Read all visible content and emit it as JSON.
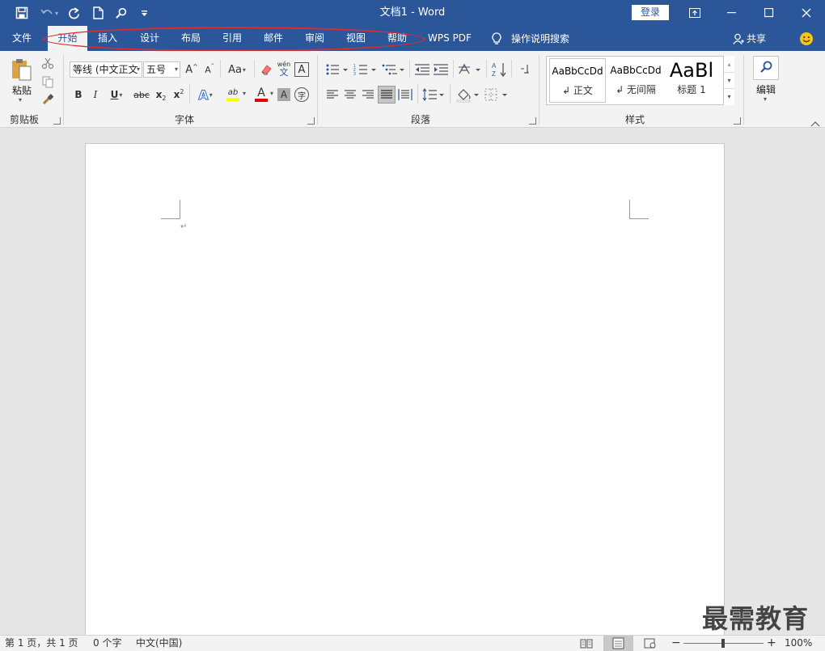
{
  "app": {
    "title": "文档1  -  Word",
    "login_label": "登录",
    "share_label": "共享",
    "tell_me": "操作说明搜索"
  },
  "tabs": [
    {
      "label": "文件"
    },
    {
      "label": "开始",
      "active": true
    },
    {
      "label": "插入"
    },
    {
      "label": "设计"
    },
    {
      "label": "布局"
    },
    {
      "label": "引用"
    },
    {
      "label": "邮件"
    },
    {
      "label": "审阅"
    },
    {
      "label": "视图"
    },
    {
      "label": "帮助"
    },
    {
      "label": "WPS PDF"
    }
  ],
  "ribbon": {
    "clipboard": {
      "label": "剪贴板",
      "paste_label": "粘贴"
    },
    "font": {
      "label": "字体",
      "font_name": "等线 (中文正文",
      "font_size": "五号",
      "aa_label": "Aa",
      "grow_label": "A",
      "shrink_label": "A",
      "bold": "B",
      "italic": "I",
      "underline": "U",
      "strike": "abc",
      "subscript": "x",
      "subscript_small": "2",
      "superscript": "x",
      "superscript_small": "2",
      "phonetic_top": "wén",
      "phonetic_bottom": "文",
      "border_char": "A",
      "effects_char": "A",
      "highlight_char": "ab",
      "color_char": "A",
      "shade_char": "A",
      "enclose_char": "字"
    },
    "paragraph": {
      "label": "段落"
    },
    "styles": {
      "label": "样式",
      "items": [
        {
          "sample": "AaBbCcDd",
          "name": "↲ 正文"
        },
        {
          "sample": "AaBbCcDd",
          "name": "↲ 无间隔"
        },
        {
          "sample": "AaBl",
          "name": "标题 1"
        }
      ]
    },
    "editing": {
      "label": "编辑"
    }
  },
  "document": {
    "paragraph_mark": "↵"
  },
  "status": {
    "page": "第 1 页，共 1 页",
    "words": "0 个字",
    "language": "中文(中国)",
    "zoom": "100%",
    "zoom_minus": "−",
    "zoom_plus": "+"
  },
  "watermark": "最需教育",
  "colors": {
    "brand": "#2b579a",
    "highlight": "#ffff00",
    "font_color": "#e00000",
    "annotation": "#e02a2a"
  }
}
